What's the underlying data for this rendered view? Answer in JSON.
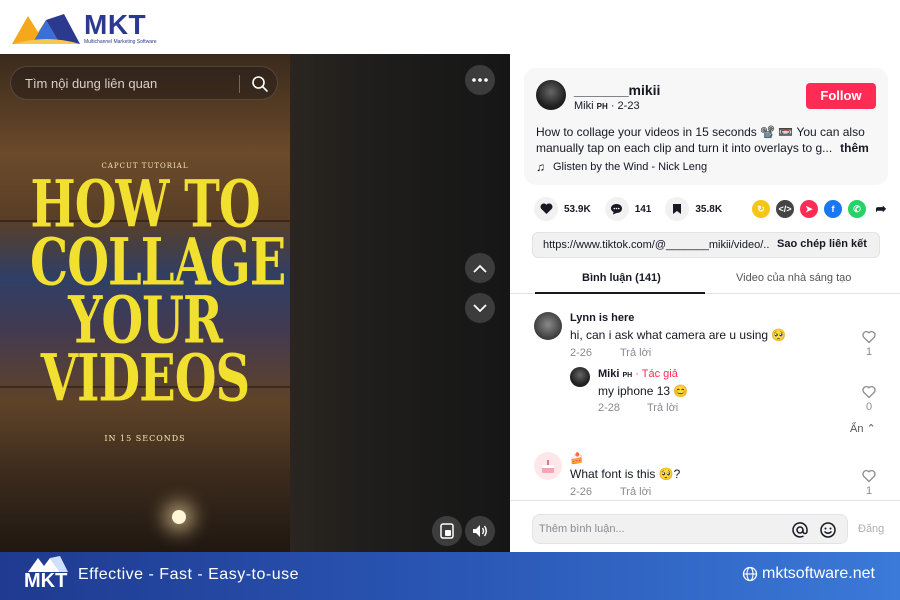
{
  "brand": {
    "name": "MKT",
    "tagline": "Multichannel Marketing Software"
  },
  "video": {
    "search_placeholder": "Tìm nội dung liên quan",
    "overlay_small": "CAPCUT TUTORIAL",
    "title_lines": [
      "HOW TO",
      "COLLAGE",
      "YOUR",
      "VIDEOS"
    ],
    "overlay_sub": "IN 15 SECONDS"
  },
  "post": {
    "author": "_______mikii",
    "author_short": "Miki",
    "author_badge": "PH",
    "date": "2-23",
    "follow_label": "Follow",
    "caption": "How to collage your videos in 15 seconds 📽️ 📼 You can also manually tap on each clip and turn it into overlays to g...",
    "more_label": "thêm",
    "music": "Glisten by the Wind - Nick Leng",
    "likes": "53.9K",
    "comments": "141",
    "saves": "35.8K",
    "link": "https://www.tiktok.com/@_______mikii/video/...",
    "copy_label": "Sao chép liên kết"
  },
  "tabs": {
    "comments": "Bình luận (141)",
    "creator": "Video của nhà sáng tạo"
  },
  "comments": [
    {
      "user": "Lynn is here",
      "text": "hi, can i ask what camera are u using 🥺",
      "date": "2-26",
      "reply": "Trả lời",
      "likes": "1"
    },
    {
      "user": "Miki",
      "badge": "PH",
      "tag": "· Tác giả",
      "text": "my iphone 13 😊",
      "date": "2-28",
      "reply": "Trả lời",
      "likes": "0"
    },
    {
      "user": "🍰",
      "text": "What font is this 🥺?",
      "date": "2-26",
      "reply": "Trả lời",
      "likes": "1"
    }
  ],
  "hide_label": "Ẩn ⌃",
  "comment_bar": {
    "placeholder": "Thêm bình luận...",
    "post_label": "Đăng"
  },
  "footer": {
    "logo": "MKT",
    "tagline": "Effective - Fast - Easy-to-use",
    "site": "mktsoftware.net"
  }
}
